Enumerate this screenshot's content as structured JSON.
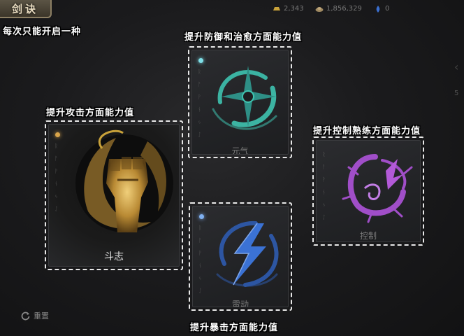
{
  "header": {
    "tab_title": "剑诀",
    "subtitle": "每次只能开启一种"
  },
  "currency": [
    {
      "icon": "gold-ingot-icon",
      "value": "2,343",
      "color": "#c9a23a"
    },
    {
      "icon": "silver-ingot-icon",
      "value": "1,856,329",
      "color": "#a08a62"
    },
    {
      "icon": "gem-icon",
      "value": "0",
      "color": "#3a6fd0"
    }
  ],
  "captions": {
    "attack": "提升攻击方面能力值",
    "defense": "提升防御和治愈方面能力值",
    "control": "提升控制熟练方面能力值",
    "crit": "提升暴击方面能力值"
  },
  "cards": {
    "douzhi": {
      "label": "斗志",
      "accent": "#c99a3c",
      "selected": true
    },
    "yuanqi": {
      "label": "元气",
      "accent": "#3fc3b0",
      "selected": false
    },
    "kongzhi": {
      "label": "控制",
      "accent": "#a04ec8",
      "selected": false
    },
    "leidong": {
      "label": "雷动",
      "accent": "#3b72d4",
      "selected": false
    }
  },
  "runes": [
    "ᚱ",
    "ᚨ",
    "ᚹ",
    "ᚾ",
    "ᛃ",
    "ᛇ"
  ],
  "footer": {
    "reset_label": "重置"
  },
  "side": {
    "mark": "5"
  }
}
